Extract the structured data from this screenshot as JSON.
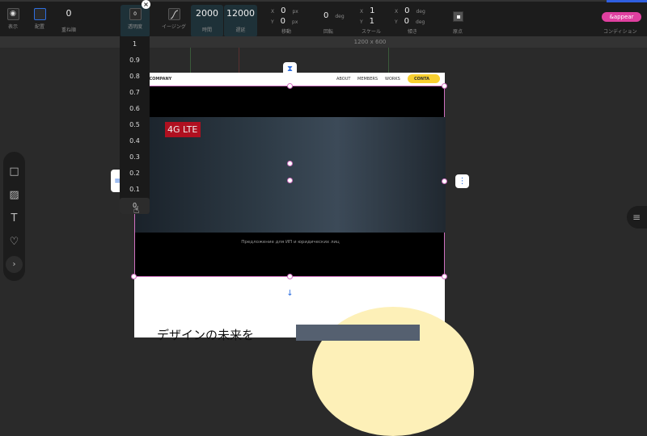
{
  "toolbar": {
    "visibility_label": "表示",
    "layout_label": "配置",
    "zorder_value": "0",
    "zorder_label": "重ね順",
    "opacity_value": "0",
    "opacity_label": "透明度",
    "easing_label": "イージング",
    "duration_value": "2000",
    "duration_label": "時間",
    "delay_value": "12000",
    "delay_label": "遅延",
    "move": {
      "x": "0",
      "y": "0",
      "unit": "px",
      "label": "移動"
    },
    "rotate": {
      "value": "0",
      "unit": "deg",
      "label": "回転"
    },
    "scale": {
      "x": "1",
      "y": "1",
      "label": "スケール"
    },
    "skew": {
      "x": "0",
      "y": "0",
      "unit": "deg",
      "label": "傾き"
    },
    "origin_label": "原点",
    "condition_value": "&appear",
    "condition_label": "コンディション",
    "x_label": "X",
    "y_label": "Y"
  },
  "ruler": {
    "size": "1200 x 600"
  },
  "opacity_options": [
    "1",
    "0.9",
    "0.8",
    "0.7",
    "0.6",
    "0.5",
    "0.4",
    "0.3",
    "0.2",
    "0.1",
    "0"
  ],
  "page": {
    "brand": "LOW COMPANY",
    "nav": [
      "ABOUT",
      "MEMBERS",
      "WORKS",
      "CONTA"
    ],
    "badge": "4G LTE",
    "caption": "Предложение для ИП и юридических лиц",
    "heading": "デザインの未来を"
  },
  "colors": {
    "accent": "#e040a0",
    "selection": "#d070c0",
    "highlight": "#1e3138"
  }
}
